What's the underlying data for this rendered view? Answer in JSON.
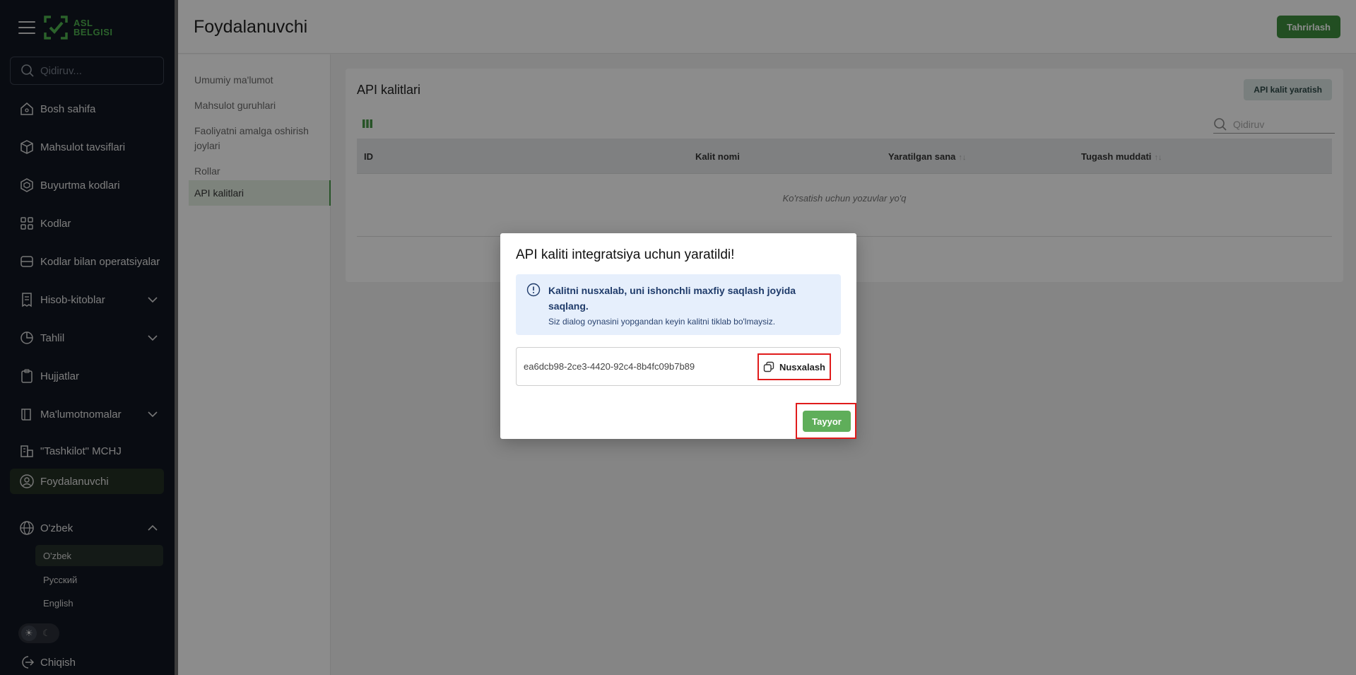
{
  "sidebar": {
    "logo_text_line1": "ASL",
    "logo_text_line2": "BELGISI",
    "search_placeholder": "Qidiruv...",
    "items": [
      {
        "label": "Bosh sahifa"
      },
      {
        "label": "Mahsulot tavsiflari"
      },
      {
        "label": "Buyurtma kodlari"
      },
      {
        "label": "Kodlar"
      },
      {
        "label": "Kodlar bilan operatsiyalar"
      },
      {
        "label": "Hisob-kitoblar"
      },
      {
        "label": "Tahlil"
      },
      {
        "label": "Hujjatlar"
      },
      {
        "label": "Ma'lumotnomalar"
      },
      {
        "label": "\"Tashkilot\" MCHJ"
      },
      {
        "label": "Foydalanuvchi"
      }
    ],
    "language": {
      "label": "O'zbek",
      "options": [
        "O'zbek",
        "Русский",
        "English"
      ]
    },
    "logout_label": "Chiqish"
  },
  "header": {
    "title": "Foydalanuvchi",
    "edit_label": "Tahrirlash"
  },
  "subnav": {
    "items": [
      "Umumiy ma'lumot",
      "Mahsulot guruhlari",
      "Faoliyatni amalga oshirish joylari",
      "Rollar",
      "API kalitlari"
    ]
  },
  "card": {
    "title": "API kalitlari",
    "create_label": "API kalit yaratish",
    "search_placeholder": "Qidiruv",
    "columns": [
      "ID",
      "Kalit nomi",
      "Yaratilgan sana",
      "Tugash muddati"
    ],
    "sort_glyph": "↑↓",
    "empty_text": "Ko'rsatish uchun yozuvlar yo'q"
  },
  "modal": {
    "title": "API kaliti integratsiya uchun yaratildi!",
    "alert_title": "Kalitni nusxalab, uni ishonchli maxfiy saqlash joyida saqlang.",
    "alert_desc": "Siz dialog oynasini yopgandan keyin kalitni tiklab bo'lmaysiz.",
    "key_value": "ea6dcb98-2ce3-4420-92c4-8b4fc09b7b89",
    "copy_label": "Nusxalash",
    "done_label": "Tayyor"
  },
  "colors": {
    "sidebar_bg": "#111722",
    "accent_green": "#5fae5a",
    "highlight_red": "#e01b1b",
    "alert_bg": "#e6effc"
  }
}
